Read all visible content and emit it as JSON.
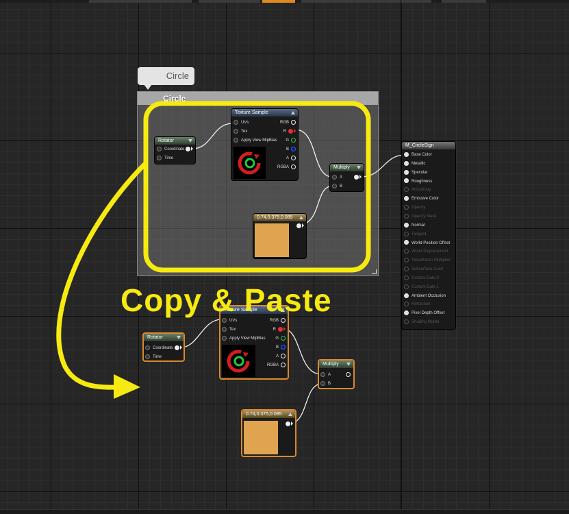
{
  "comment": {
    "bubble_label": "Circle",
    "header_label": "Circle"
  },
  "annotation": {
    "text": "Copy & Paste",
    "color": "#f6ea10"
  },
  "original": {
    "rotator": {
      "title": "Rotator",
      "inputs": [
        "Coordinate",
        "Time"
      ]
    },
    "texture_sample": {
      "title": "Texture Sample",
      "inputs": [
        "UVs",
        "Tex",
        "Apply View MipBias"
      ],
      "outputs": [
        "RGB",
        "R",
        "G",
        "B",
        "A",
        "RGBA"
      ]
    },
    "multiply": {
      "title": "Multiply",
      "inputs": [
        "A",
        "B"
      ]
    },
    "constant": {
      "title": "0.74,0.375,0.085",
      "color": "#e0a451"
    }
  },
  "pasted": {
    "rotator": {
      "title": "Rotator",
      "inputs": [
        "Coordinate",
        "Time"
      ]
    },
    "texture_sample": {
      "title": "Texture Sample",
      "inputs": [
        "UVs",
        "Tex",
        "Apply View MipBias"
      ],
      "outputs": [
        "RGB",
        "R",
        "G",
        "B",
        "A",
        "RGBA"
      ]
    },
    "multiply": {
      "title": "Multiply",
      "inputs": [
        "A",
        "B"
      ]
    },
    "constant": {
      "title": "0.74,0.375,0.085",
      "color": "#e0a451"
    }
  },
  "material": {
    "title": "M_CircleSign",
    "inputs": [
      "Base Color",
      "Metallic",
      "Specular",
      "Roughness",
      "Anisotropy",
      "Emissive Color",
      "Opacity",
      "Opacity Mask",
      "Normal",
      "Tangent",
      "World Position Offset",
      "World Displacement",
      "Tessellation Multiplier",
      "Subsurface Color",
      "Custom Data 0",
      "Custom Data 1",
      "Ambient Occlusion",
      "Refraction",
      "Pixel Depth Offset",
      "Shading Model"
    ]
  },
  "colors": {
    "selection": "#d98a2b",
    "swatch": "#e0a451",
    "highlight": "#f6ea10"
  }
}
